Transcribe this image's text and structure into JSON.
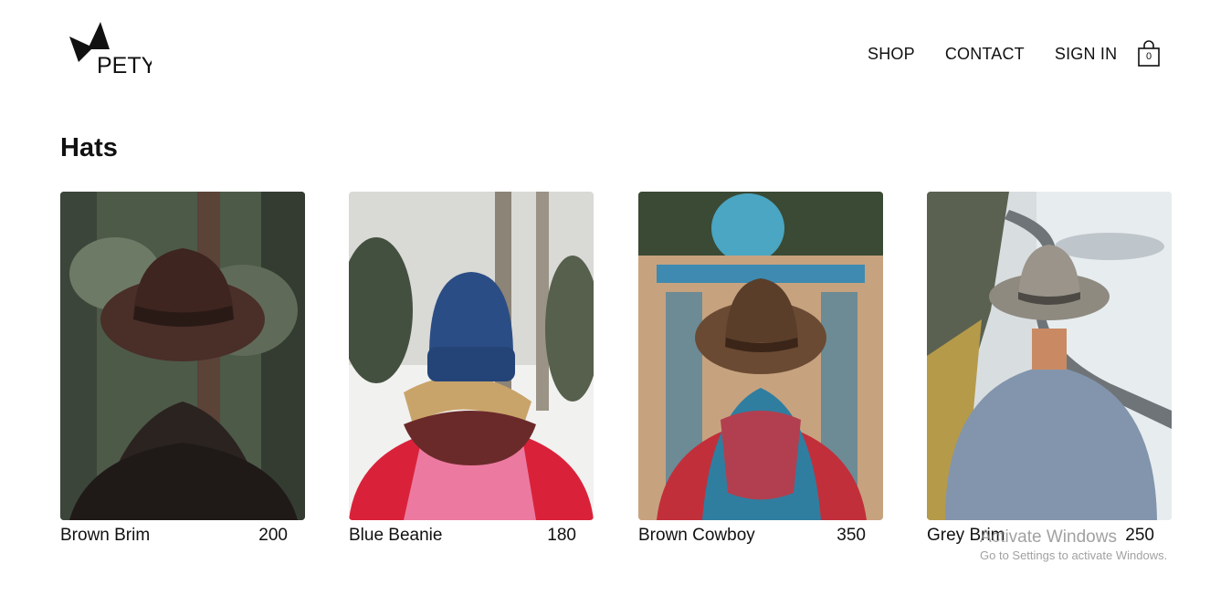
{
  "header": {
    "logo_text": "PETY",
    "nav": [
      {
        "label": "SHOP"
      },
      {
        "label": "CONTACT"
      },
      {
        "label": "SIGN IN"
      }
    ],
    "cart": {
      "icon": "shopping-bag-icon",
      "count": "0"
    }
  },
  "page": {
    "title": "Hats"
  },
  "products": [
    {
      "name": "Brown Brim",
      "price": "200",
      "image": "woman-in-brown-brim-hat-forest"
    },
    {
      "name": "Blue Beanie",
      "price": "180",
      "image": "woman-in-blue-beanie-snow"
    },
    {
      "name": "Brown Cowboy",
      "price": "350",
      "image": "person-in-brown-cowboy-hat-mosque"
    },
    {
      "name": "Grey Brim",
      "price": "250",
      "image": "man-in-grey-brim-hat-coastal-road"
    }
  ],
  "os_watermark": {
    "title": "Activate Windows",
    "subtitle": "Go to Settings to activate Windows."
  },
  "colors": {
    "text": "#111111",
    "background": "#ffffff"
  }
}
